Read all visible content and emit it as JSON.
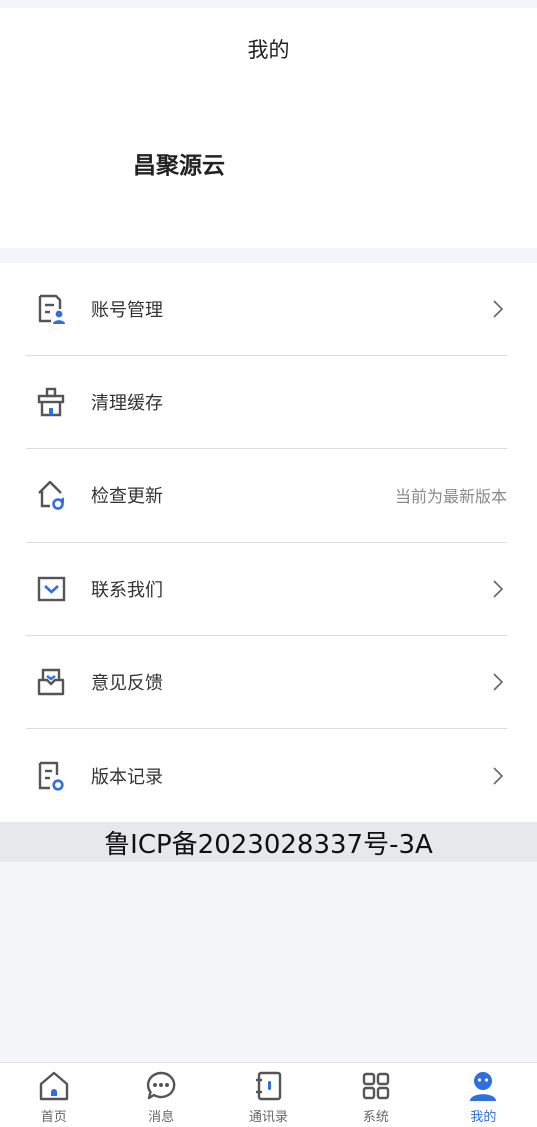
{
  "header": {
    "title": "我的",
    "user_name": "昌聚源云"
  },
  "menu": [
    {
      "label": "账号管理",
      "icon": "account-doc-icon",
      "right": "",
      "chevron": true
    },
    {
      "label": "清理缓存",
      "icon": "basket-icon",
      "right": "",
      "chevron": false
    },
    {
      "label": "检查更新",
      "icon": "home-update-icon",
      "right": "当前为最新版本",
      "chevron": false
    },
    {
      "label": "联系我们",
      "icon": "mail-box-icon",
      "right": "",
      "chevron": true
    },
    {
      "label": "意见反馈",
      "icon": "inbox-icon",
      "right": "",
      "chevron": true
    },
    {
      "label": "版本记录",
      "icon": "version-doc-icon",
      "right": "",
      "chevron": true
    }
  ],
  "footer_text": "鲁ICP备2023028337号-3A",
  "tabbar": [
    {
      "label": "首页",
      "icon": "home-icon",
      "active": false
    },
    {
      "label": "消息",
      "icon": "chat-icon",
      "active": false
    },
    {
      "label": "通讯录",
      "icon": "contacts-book-icon",
      "active": false
    },
    {
      "label": "系统",
      "icon": "grid-icon",
      "active": false
    },
    {
      "label": "我的",
      "icon": "profile-icon",
      "active": true
    }
  ],
  "colors": {
    "accent": "#2f6fe0",
    "icon_gray": "#555555",
    "divider": "#dcdde0",
    "background": "#f4f5f7"
  }
}
